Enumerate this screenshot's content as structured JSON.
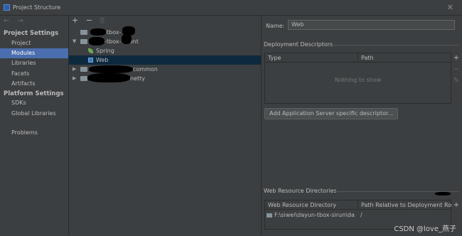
{
  "window": {
    "title": "Project Structure",
    "close_glyph": "✕"
  },
  "sidebar": {
    "nav_glyphs": "← →",
    "project_settings_heading": "Project Settings",
    "project_items": [
      {
        "label": "Project"
      },
      {
        "label": "Modules",
        "selected": true
      },
      {
        "label": "Libraries"
      },
      {
        "label": "Facets"
      },
      {
        "label": "Artifacts"
      }
    ],
    "platform_settings_heading": "Platform Settings",
    "platform_items": [
      {
        "label": "SDKs"
      },
      {
        "label": "Global Libraries"
      }
    ],
    "other_items": [
      {
        "label": "Problems"
      }
    ]
  },
  "tree": {
    "toolbar": {
      "add": "+",
      "remove": "−",
      "copy": "⎘"
    },
    "rows": [
      {
        "label": "-tbox-",
        "expanded": false
      },
      {
        "label": "-tbox-    client",
        "expanded": true
      },
      {
        "label": "Spring"
      },
      {
        "label": "Web",
        "selected": true
      },
      {
        "label": "common",
        "expanded": false
      },
      {
        "label": "netty",
        "expanded": false
      }
    ]
  },
  "detail": {
    "name_label": "Name:",
    "name_value": "Web",
    "deployment_descriptors": {
      "title": "Deployment Descriptors",
      "columns": [
        "Type",
        "Path"
      ],
      "empty_text": "Nothing to show",
      "add_button": "Add Application Server specific descriptor..."
    },
    "web_resource_directories": {
      "title": "Web Resource Directories",
      "columns": [
        "Web Resource Directory",
        "Path Relative to Deployment Root"
      ],
      "rows": [
        {
          "directory": "F:\\siwei\\dayun-tbox-sirun\\da...",
          "relative_path": "/"
        }
      ]
    },
    "tools": {
      "add": "+",
      "remove": "−",
      "edit": "✎"
    }
  },
  "watermark": "CSDN @love_燕子"
}
